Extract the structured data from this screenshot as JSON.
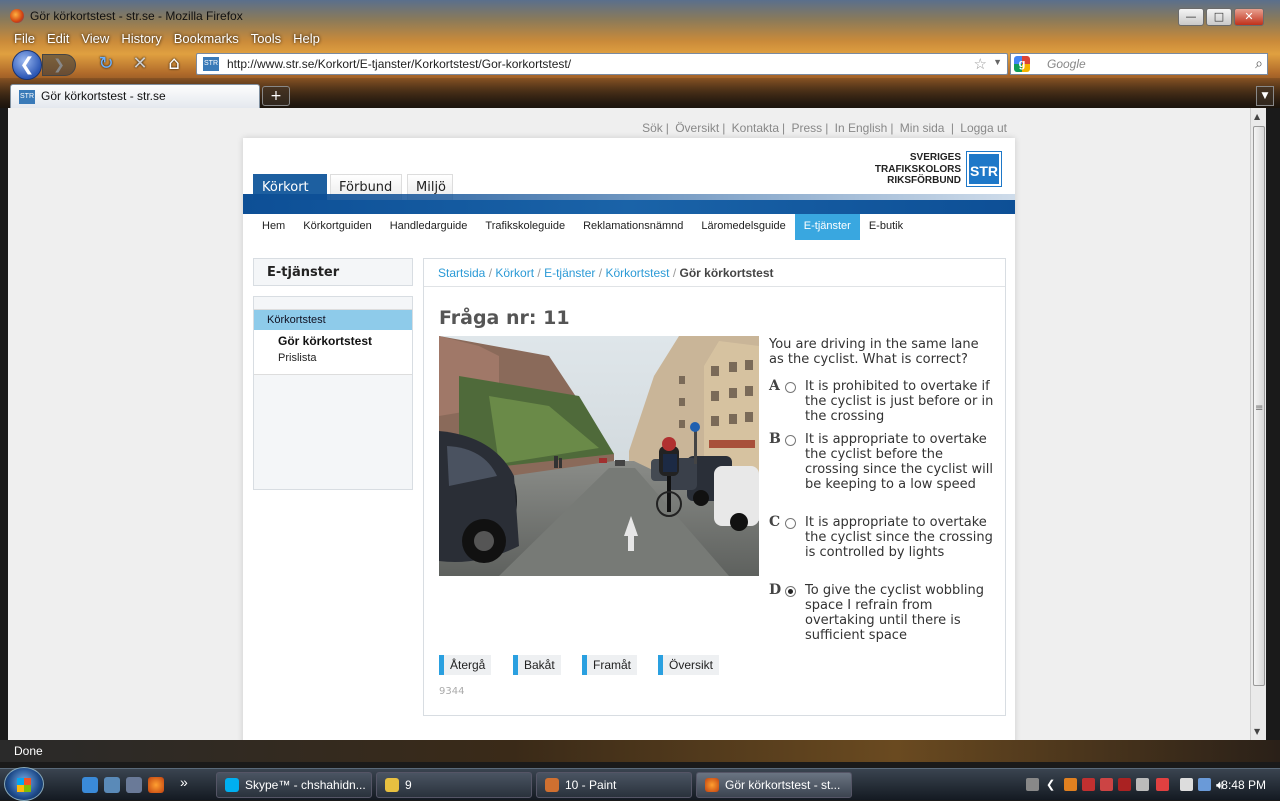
{
  "window": {
    "title": "Gör körkortstest - str.se - Mozilla Firefox",
    "min": "—",
    "max": "□",
    "close": "✕"
  },
  "menu": [
    "File",
    "Edit",
    "View",
    "History",
    "Bookmarks",
    "Tools",
    "Help"
  ],
  "nav": {
    "back": "❮",
    "forward": "❯",
    "url_site_badge": "STR",
    "url": "http://www.str.se/Korkort/E-tjanster/Korkortstest/Gor-korkortstest/",
    "search_placeholder": "Google"
  },
  "tabs": {
    "active": "Gör körkortstest - str.se",
    "badge": "STR",
    "new": "+",
    "list": "▼"
  },
  "site": {
    "toplinks": [
      "Sök",
      "Översikt",
      "Kontakta",
      "Press",
      "In English",
      "Min sida",
      "Logga ut"
    ],
    "logo_lines": [
      "SVERIGES",
      "TRAFIKSKOLORS",
      "RIKSFÖRBUND"
    ],
    "logo_box": "STR",
    "top_tabs": [
      "Körkort",
      "Förbund",
      "Miljö"
    ],
    "subnav": [
      "Hem",
      "Körkortguiden",
      "Handledarguide",
      "Trafikskoleguide",
      "Reklamationsnämnd",
      "Läromedelsguide",
      "E-tjänster",
      "E-butik"
    ],
    "sidebar": {
      "heading": "E-tjänster",
      "active": "Körkortstest",
      "sub1": "Gör körkortstest",
      "sub2": "Prislista"
    },
    "breadcrumb": [
      "Startsida",
      "Körkort",
      "E-tjänster",
      "Körkortstest"
    ],
    "breadcrumb_current": "Gör körkortstest",
    "question_title": "Fråga nr: 11",
    "question": "You are driving in the same lane as the cyclist. What is correct?",
    "options": [
      {
        "letter": "A",
        "text": "It is prohibited to overtake if the cyclist is just before or in the crossing",
        "selected": false
      },
      {
        "letter": "B",
        "text": "It is appropriate to overtake the cyclist before the crossing since the cyclist will be keeping to a low speed",
        "selected": false
      },
      {
        "letter": "C",
        "text": "It is appropriate to overtake the cyclist since the crossing is controlled by lights",
        "selected": false
      },
      {
        "letter": "D",
        "text": "To give the cyclist wobbling space I refrain from overtaking until there is sufficient space",
        "selected": true
      }
    ],
    "buttons": [
      "Återgå",
      "Bakåt",
      "Framåt",
      "Översikt"
    ],
    "id_number": "9344"
  },
  "status": "Done",
  "taskbar": {
    "tasks": [
      "Skype™ - chshahidn...",
      "9",
      "10 - Paint",
      "Gör körkortstest - st..."
    ],
    "clock": "8:48 PM",
    "more": "»"
  }
}
